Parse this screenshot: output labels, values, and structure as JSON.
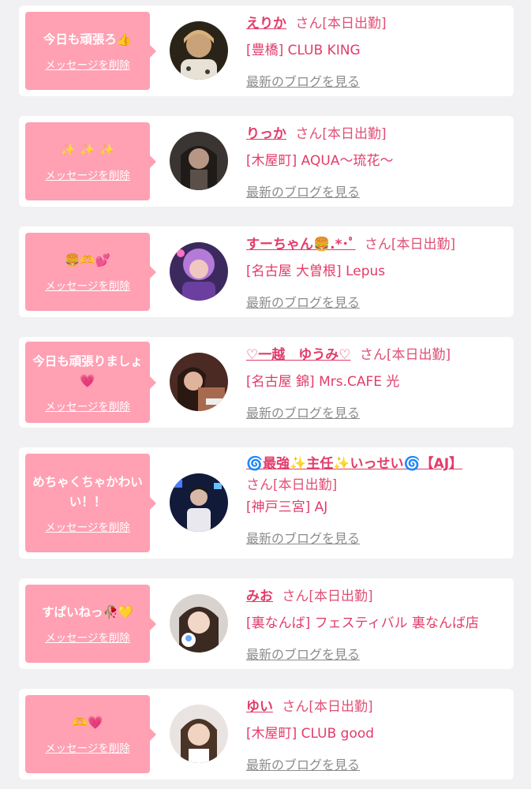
{
  "delete_label": "メッセージを削除",
  "blog_label": "最新のブログを見る",
  "status_suffix": "さん[本日出勤]",
  "colors": {
    "page_bg": "#f1f1f3",
    "bubble": "#ffa0b3",
    "accent": "#e23c6a",
    "link_grey": "#8c8c8c"
  },
  "entries": [
    {
      "message": "今日も頑張ろ👍",
      "name": "えりか",
      "shop": "[豊橋] CLUB KING"
    },
    {
      "message": "✨ ✨ ✨",
      "name": "りっか",
      "shop": "[木屋町] AQUA～琉花～"
    },
    {
      "message": "🍔🫶💕",
      "name": "すーちゃん🍔.*･ﾟ",
      "shop": "[名古屋 大曽根] Lepus"
    },
    {
      "message": "今日も頑張りましょ💗",
      "name": "♡一越　ゆうみ♡",
      "shop": "[名古屋 錦] Mrs.CAFE 光"
    },
    {
      "message": "めちゃくちゃかわいい！！",
      "name": "🌀最強✨主任✨いっせい🌀【AJ】",
      "shop": "[神戸三宮] AJ"
    },
    {
      "message": "すぱいねっ🥀💛",
      "name": "みお",
      "shop": "[裏なんば] フェスティバル 裏なんば店"
    },
    {
      "message": "🫶💗",
      "name": "ゆい",
      "shop": "[木屋町] CLUB good"
    }
  ]
}
